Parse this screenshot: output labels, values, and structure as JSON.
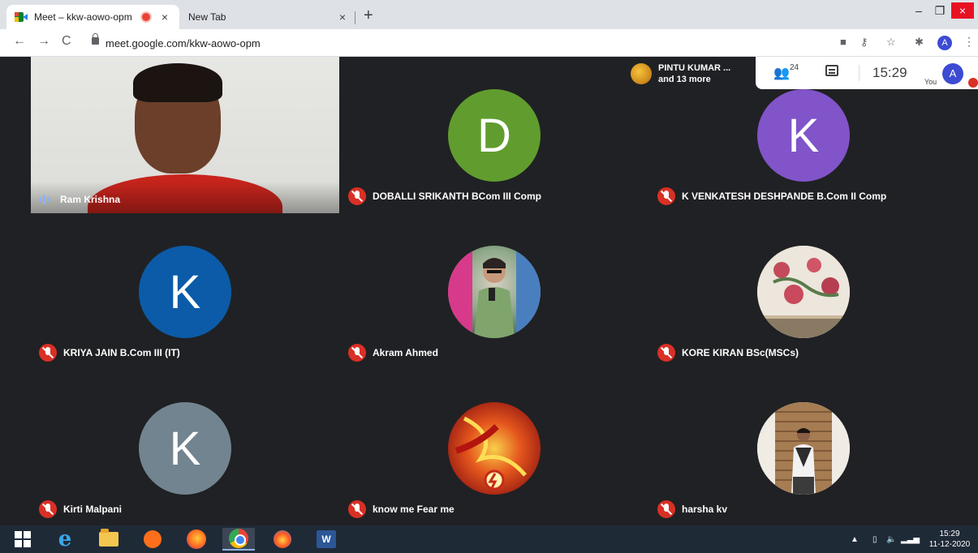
{
  "browser": {
    "tabs": [
      {
        "title": "Meet – kkw-aowo-opm",
        "close": "×"
      },
      {
        "title": "New Tab",
        "close": "×"
      }
    ],
    "new_tab": "+",
    "window": {
      "minimize": "–",
      "maximize": "❐",
      "close": "×"
    },
    "url": "meet.google.com/kkw-aowo-opm",
    "nav": {
      "back": "←",
      "forward": "→",
      "reload": "C"
    },
    "profile_initial": "A",
    "icons": [
      "camera-icon",
      "key-icon",
      "star-icon",
      "extensions-icon"
    ]
  },
  "meet": {
    "presenter": {
      "line1": "PINTU KUMAR ...",
      "line2": "and 13 more"
    },
    "participants_count": "24",
    "time": "15:29",
    "you_label": "You",
    "you_initial": "A",
    "tiles": [
      {
        "name": "Ram Krishna",
        "type": "video",
        "speaking": true
      },
      {
        "name": "DOBALLI SRIKANTH BCom III Comp",
        "initial": "D",
        "color": "#609d2e",
        "muted": true
      },
      {
        "name": "K VENKATESH DESHPANDE B.Com II Comp",
        "initial": "K",
        "color": "#8154c9",
        "muted": true
      },
      {
        "name": "KRIYA JAIN B.Com III (IT)",
        "initial": "K",
        "color": "#0b5ba8",
        "muted": true
      },
      {
        "name": "Akram Ahmed",
        "type": "photo",
        "muted": true
      },
      {
        "name": "KORE KIRAN BSc(MSCs)",
        "type": "photo",
        "muted": true
      },
      {
        "name": "Kirti Malpani",
        "initial": "K",
        "color": "#72848f",
        "muted": true
      },
      {
        "name": "know me Fear me",
        "type": "photo",
        "muted": true
      },
      {
        "name": "harsha kv",
        "type": "photo",
        "muted": true
      }
    ]
  },
  "taskbar": {
    "time": "15:29",
    "date": "11-12-2020",
    "word_label": "W"
  }
}
